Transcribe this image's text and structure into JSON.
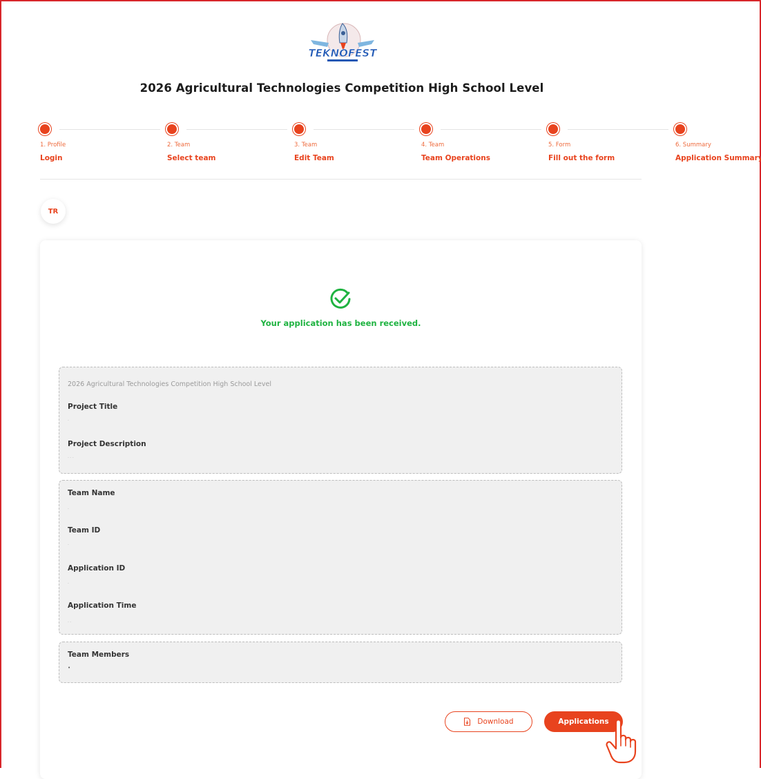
{
  "header": {
    "logo_text": "TEKNOFEST",
    "page_title": "2026 Agricultural Technologies Competition High School Level"
  },
  "steps": [
    {
      "number": "1. Profile",
      "name": "Login"
    },
    {
      "number": "2. Team",
      "name": "Select team"
    },
    {
      "number": "3. Team",
      "name": "Edit Team"
    },
    {
      "number": "4. Team",
      "name": "Team Operations"
    },
    {
      "number": "5. Form",
      "name": "Fill out the form"
    },
    {
      "number": "6. Summary",
      "name": "Application Summary"
    }
  ],
  "language": {
    "label": "TR"
  },
  "summary": {
    "status_message": "Your application has been received.",
    "competition_name": "2026 Agricultural Technologies Competition High School Level",
    "fields": {
      "project_title_label": "Project Title",
      "project_title_value": "-",
      "project_description_label": "Project Description",
      "project_description_value": "- - -",
      "team_name_label": "Team Name",
      "team_name_value": "-",
      "team_id_label": "Team ID",
      "team_id_value": "-",
      "application_id_label": "Application ID",
      "application_id_value": "-",
      "application_time_label": "Application Time",
      "application_time_value": "- -",
      "team_members_label": "Team Members",
      "team_members_value": "•"
    }
  },
  "actions": {
    "download_label": "Download",
    "applications_label": "Applications"
  },
  "colors": {
    "accent": "#e8431e",
    "success": "#1fb341",
    "frame": "#d8262b",
    "box_bg": "#f0f0f0"
  }
}
